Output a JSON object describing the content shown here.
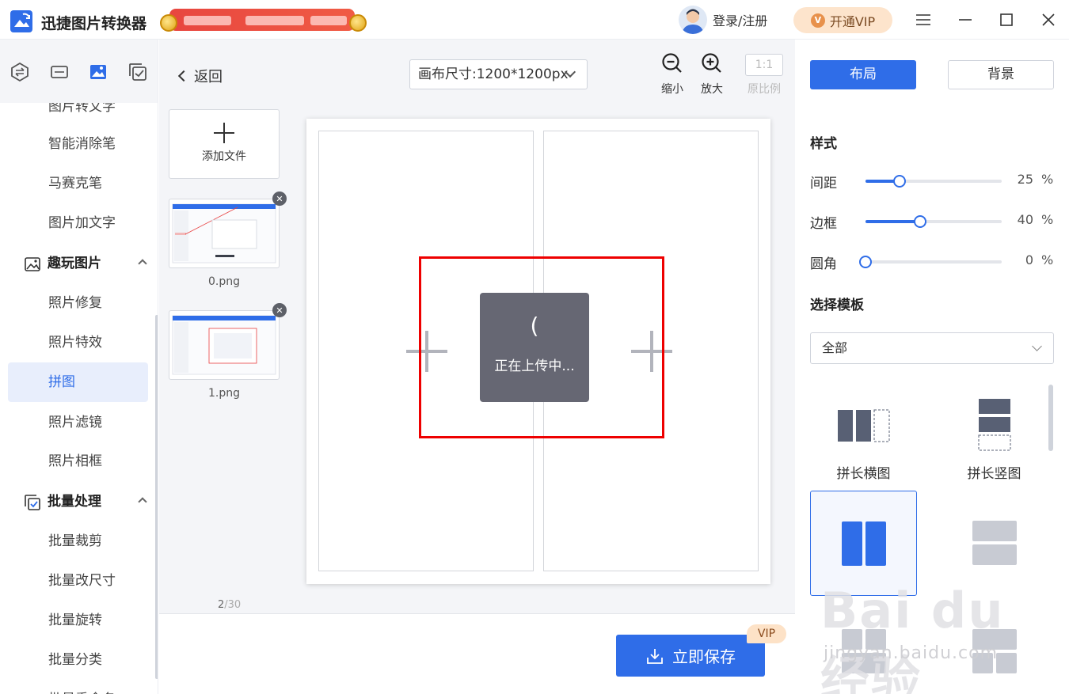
{
  "app": {
    "title": "迅捷图片转换器",
    "login_label": "登录/注册",
    "vip_label": "开通VIP"
  },
  "colors": {
    "accent": "#2f6de8",
    "highlight_box": "#ee0000",
    "vip_bg": "#fde4cc"
  },
  "sidebar": {
    "partial_top_label": "图片转文字",
    "items_a": [
      "智能消除笔",
      "马赛克笔",
      "图片加文字"
    ],
    "group_fun": "趣玩图片",
    "items_fun": [
      "照片修复",
      "照片特效",
      "拼图",
      "照片滤镜",
      "照片相框"
    ],
    "active_item": "拼图",
    "group_batch": "批量处理",
    "items_batch": [
      "批量裁剪",
      "批量改尺寸",
      "批量旋转",
      "批量分类",
      "批量重命名"
    ]
  },
  "editor": {
    "back_label": "返回",
    "canvas_size_label": "画布尺寸:1200*1200px",
    "zoom_out_label": "缩小",
    "zoom_in_label": "放大",
    "ratio_box": "1:1",
    "ratio_label": "原比例",
    "add_file_label": "添加文件",
    "files": [
      "0.png",
      "1.png"
    ],
    "counter_current": "2",
    "counter_total": "/30",
    "uploading_text": "正在上传中...",
    "spinner_glyph": "(",
    "save_label": "立即保存",
    "vip_tag": "VIP"
  },
  "right_panel": {
    "tab_layout": "布局",
    "tab_background": "背景",
    "style_title": "样式",
    "sliders": [
      {
        "label": "间距",
        "value": "25",
        "unit": "%",
        "fraction": 0.25
      },
      {
        "label": "边框",
        "value": "40",
        "unit": "%",
        "fraction": 0.4
      },
      {
        "label": "圆角",
        "value": "0",
        "unit": "%",
        "fraction": 0.0
      }
    ],
    "template_title": "选择模板",
    "template_filter": "全部",
    "templates": [
      "拼长横图",
      "拼长竖图"
    ]
  },
  "watermark": {
    "big": "Bai du 经验",
    "small": "jingyan.baidu.com"
  }
}
